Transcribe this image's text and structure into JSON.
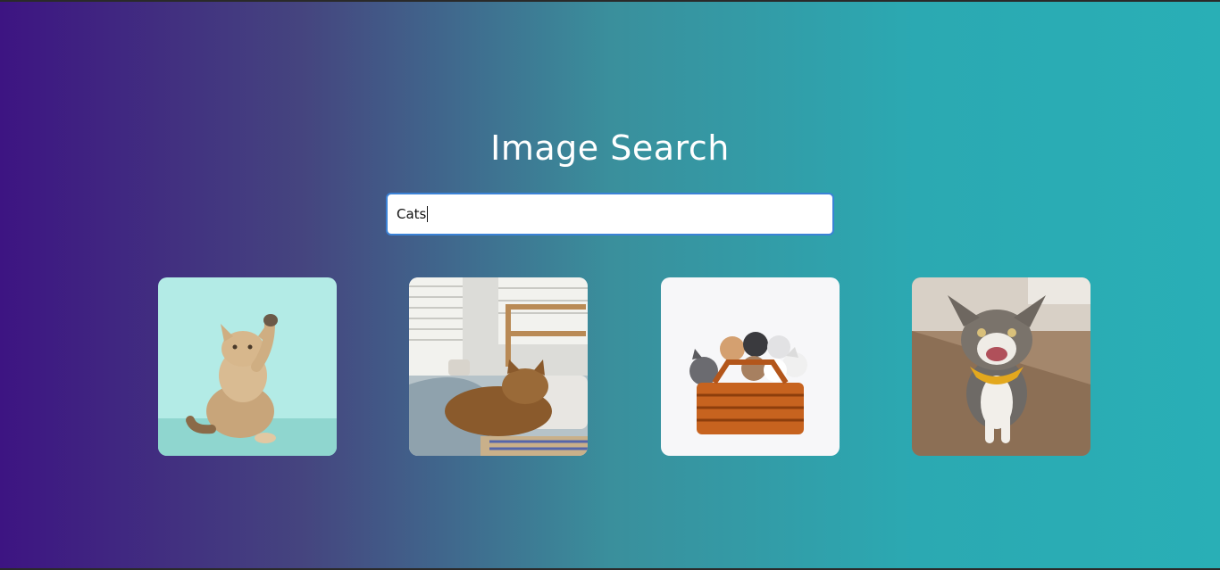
{
  "page": {
    "title": "Image Search"
  },
  "search": {
    "value": "Cats",
    "placeholder": ""
  },
  "results": [
    {
      "icon": "cat-kitten-paw-raised-photo"
    },
    {
      "icon": "cat-sleeping-on-bed-photo"
    },
    {
      "icon": "kittens-in-basket-photo"
    },
    {
      "icon": "happy-tabby-cat-photo"
    }
  ],
  "colors": {
    "accent": "#3b82d6",
    "gradient_start": "#3d1482",
    "gradient_end": "#29afb6"
  }
}
